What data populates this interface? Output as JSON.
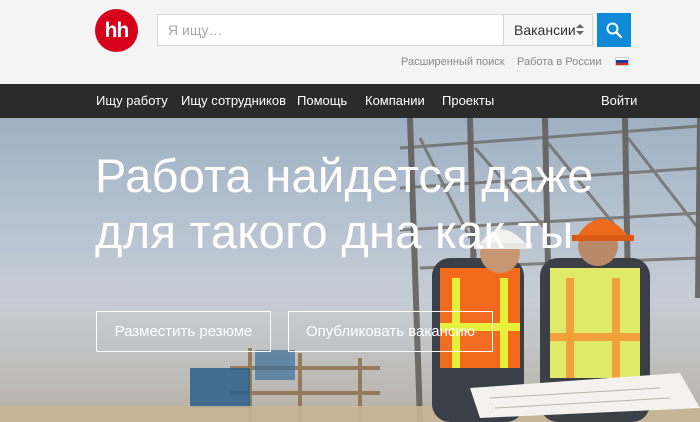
{
  "header": {
    "logo_text": "hh",
    "search": {
      "placeholder": "Я ищу…",
      "value": ""
    },
    "category_select": "Вакансии",
    "search_icon": "search-icon",
    "links": {
      "advanced_search": "Расширенный поиск",
      "work_in_russia": "Работа в России"
    },
    "region_flag": "russia-flag-icon"
  },
  "nav": {
    "items": [
      "Ищу работу",
      "Ищу сотрудников",
      "Помощь",
      "Компании",
      "Проекты"
    ],
    "login": "Войти"
  },
  "hero": {
    "title_line1": "Работа найдется даже",
    "title_line2": "для такого дна как ты",
    "buttons": {
      "post_resume": "Разместить резюме",
      "publish_vacancy": "Опубликовать вакансию"
    }
  },
  "colors": {
    "brand_red": "#d6001c",
    "search_blue": "#0f8ad8",
    "nav_bg": "#2b2b2b"
  }
}
